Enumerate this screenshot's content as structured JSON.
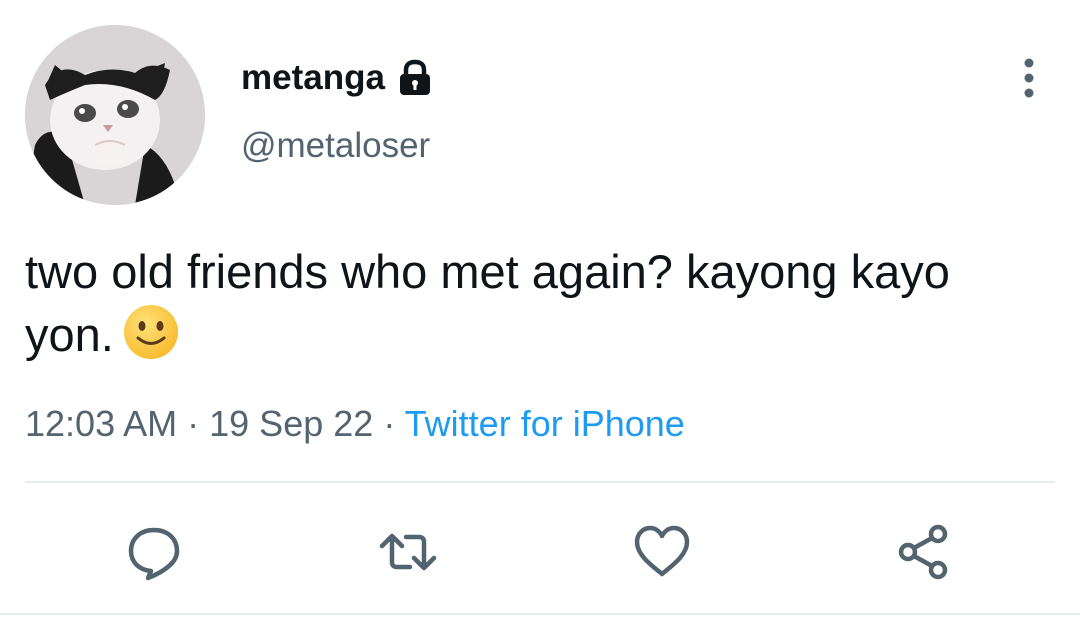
{
  "user": {
    "display_name": "metanga",
    "handle": "@metaloser",
    "avatar": "cat-avatar",
    "protected_icon": "lock-icon"
  },
  "tweet": {
    "text": "two old friends who met again? kayong kayo yon.",
    "emoji": "slightly-smiling-face"
  },
  "meta": {
    "time": "12:03 AM",
    "separator": "·",
    "date": "19 Sep 22",
    "source": "Twitter for iPhone"
  },
  "actions": [
    {
      "name": "reply",
      "icon": "comment-icon"
    },
    {
      "name": "retweet",
      "icon": "retweet-icon"
    },
    {
      "name": "like",
      "icon": "heart-icon"
    },
    {
      "name": "share",
      "icon": "share-icon"
    }
  ],
  "colors": {
    "text": "#0f1419",
    "secondary": "#536471",
    "link": "#1d9bf0",
    "divider": "#e6ecf0"
  }
}
